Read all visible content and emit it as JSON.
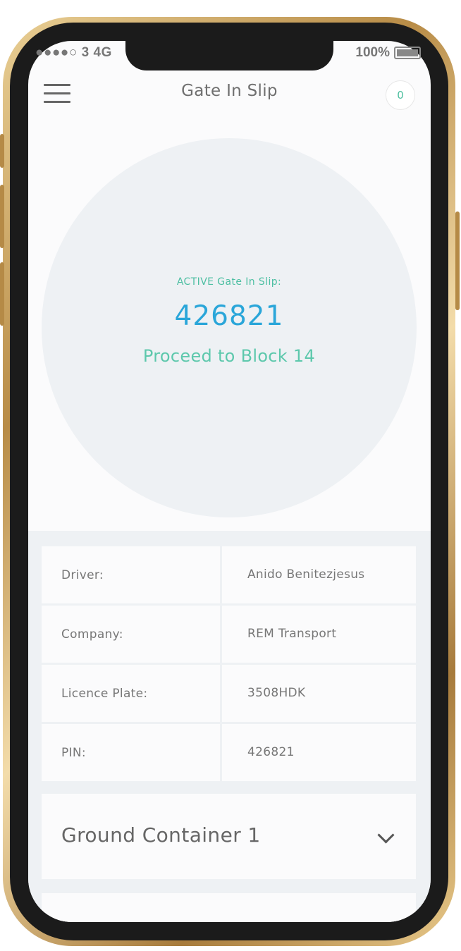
{
  "status_bar": {
    "carrier": "●●●●○ 3",
    "network": "4G",
    "battery": "100%"
  },
  "header": {
    "title": "Gate In Slip",
    "counter": "0",
    "menu_icon": "hamburger-menu-icon"
  },
  "active_slip": {
    "label": "ACTIVE Gate In Slip:",
    "number": "426821",
    "instruction": "Proceed to Block 14"
  },
  "details": [
    {
      "label": "Driver:",
      "value": "Anido Benitezjesus"
    },
    {
      "label": "Company:",
      "value": "REM Transport"
    },
    {
      "label": "Licence Plate:",
      "value": "3508HDK"
    },
    {
      "label": "PIN:",
      "value": "426821"
    }
  ],
  "containers": [
    {
      "title": "Ground Container 1",
      "icon": "chevron-down-icon"
    }
  ],
  "colors": {
    "accent_teal": "#4dbfa2",
    "accent_blue": "#2aa6d9",
    "background": "#eef1f4"
  }
}
